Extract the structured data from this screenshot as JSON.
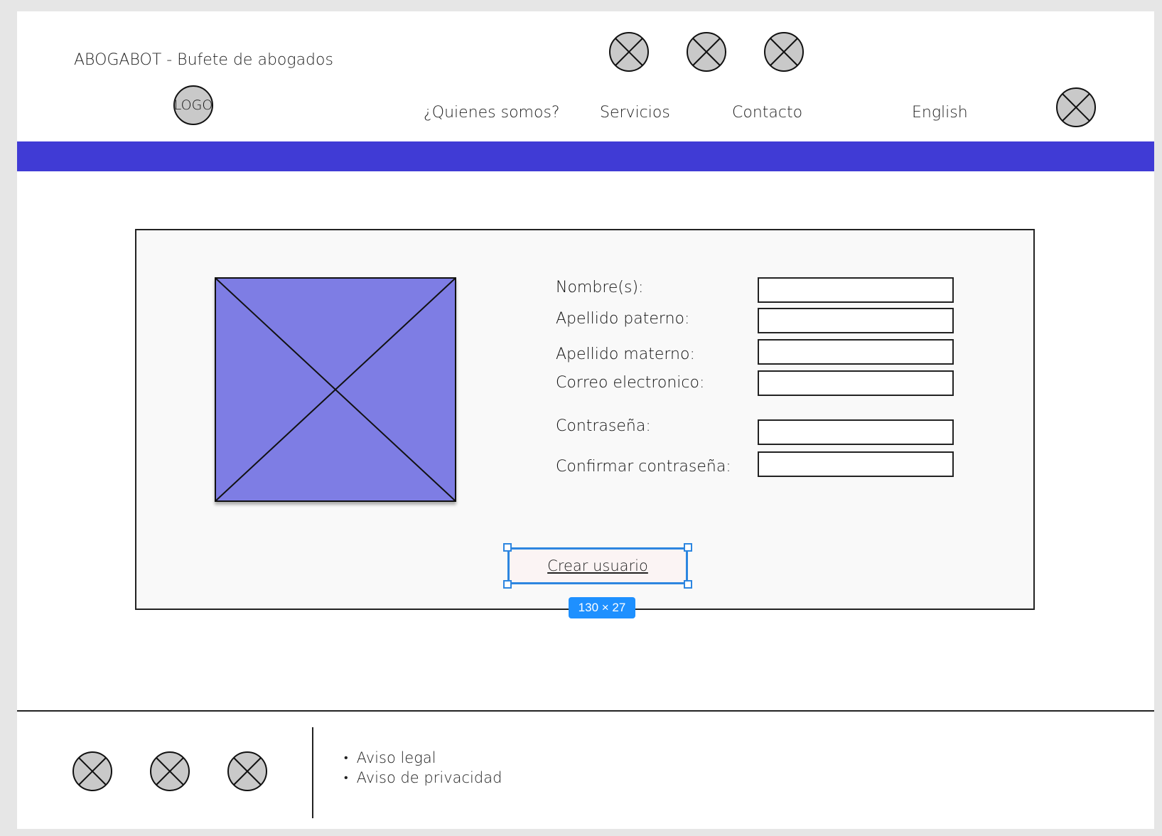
{
  "header": {
    "brand": "ABOGABOT - Bufete de abogados",
    "logo_text": "LOGO",
    "top_icons": [
      "placeholder-icon",
      "placeholder-icon",
      "placeholder-icon"
    ],
    "nav": [
      {
        "label": "¿Quienes somos?"
      },
      {
        "label": "Servicios"
      },
      {
        "label": "Contacto"
      },
      {
        "label": "English"
      }
    ],
    "band_color": "#403bd5"
  },
  "form": {
    "image_icon": "image-placeholder-icon",
    "fields": [
      {
        "label": "Nombre(s):",
        "value": ""
      },
      {
        "label": "Apellido paterno:",
        "value": ""
      },
      {
        "label": "Apellido materno:",
        "value": ""
      },
      {
        "label": "Correo electronico:",
        "value": ""
      },
      {
        "label": "Contraseña:",
        "value": ""
      },
      {
        "label": "Confirmar contraseña:",
        "value": ""
      }
    ],
    "submit_label": "Crear usuario",
    "selection_size": "130 × 27"
  },
  "footer": {
    "social_icons": [
      "placeholder-icon",
      "placeholder-icon",
      "placeholder-icon"
    ],
    "links": [
      "Aviso legal",
      "Aviso de privacidad"
    ]
  }
}
